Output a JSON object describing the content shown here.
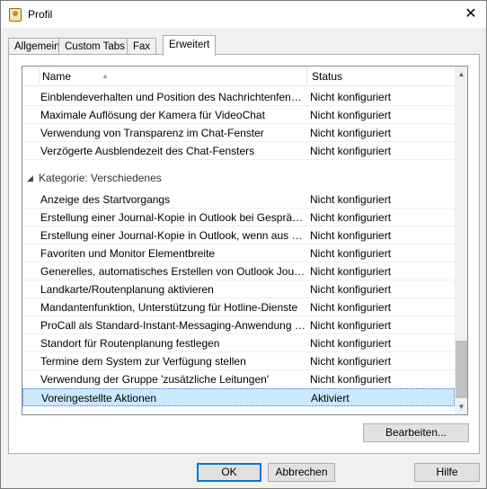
{
  "window": {
    "title": "Profil",
    "close_glyph": "✕"
  },
  "tabs": [
    {
      "label": "Allgemein"
    },
    {
      "label": "Custom Tabs"
    },
    {
      "label": "Fax"
    },
    {
      "label": "Erweitert"
    }
  ],
  "active_tab": "Erweitert",
  "list": {
    "columns": {
      "name": "Name",
      "status": "Status"
    },
    "rows_top": [
      {
        "name": "Einblendeverhalten und Position des Nachrichtenfenst...",
        "status": "Nicht konfiguriert"
      },
      {
        "name": "Maximale Auflösung der Kamera für VideoChat",
        "status": "Nicht konfiguriert"
      },
      {
        "name": "Verwendung von Transparenz im Chat-Fenster",
        "status": "Nicht konfiguriert"
      },
      {
        "name": "Verzögerte Ausblendezeit des Chat-Fensters",
        "status": "Nicht konfiguriert"
      }
    ],
    "group": {
      "label": "Kategorie: Verschiedenes"
    },
    "rows_group": [
      {
        "name": "Anzeige des Startvorgangs",
        "status": "Nicht konfiguriert"
      },
      {
        "name": "Erstellung einer Journal-Kopie in Outlook bei Gespräch...",
        "status": "Nicht konfiguriert"
      },
      {
        "name": "Erstellung einer Journal-Kopie in Outlook, wenn aus ei...",
        "status": "Nicht konfiguriert"
      },
      {
        "name": "Favoriten und Monitor Elementbreite",
        "status": "Nicht konfiguriert"
      },
      {
        "name": "Generelles, automatisches Erstellen von Outlook Journ...",
        "status": "Nicht konfiguriert"
      },
      {
        "name": "Landkarte/Routenplanung aktivieren",
        "status": "Nicht konfiguriert"
      },
      {
        "name": "Mandantenfunktion, Unterstützung für Hotline-Dienste",
        "status": "Nicht konfiguriert"
      },
      {
        "name": "ProCall als Standard-Instant-Messaging-Anwendung r...",
        "status": "Nicht konfiguriert"
      },
      {
        "name": "Standort für Routenplanung festlegen",
        "status": "Nicht konfiguriert"
      },
      {
        "name": "Termine dem System zur Verfügung stellen",
        "status": "Nicht konfiguriert"
      },
      {
        "name": "Verwendung der Gruppe 'zusätzliche Leitungen'",
        "status": "Nicht konfiguriert"
      },
      {
        "name": "Voreingestellte Aktionen",
        "status": "Aktiviert",
        "selected": true
      }
    ]
  },
  "buttons": {
    "edit": "Bearbeiten...",
    "ok": "OK",
    "cancel": "Abbrechen",
    "help": "Hilfe"
  }
}
